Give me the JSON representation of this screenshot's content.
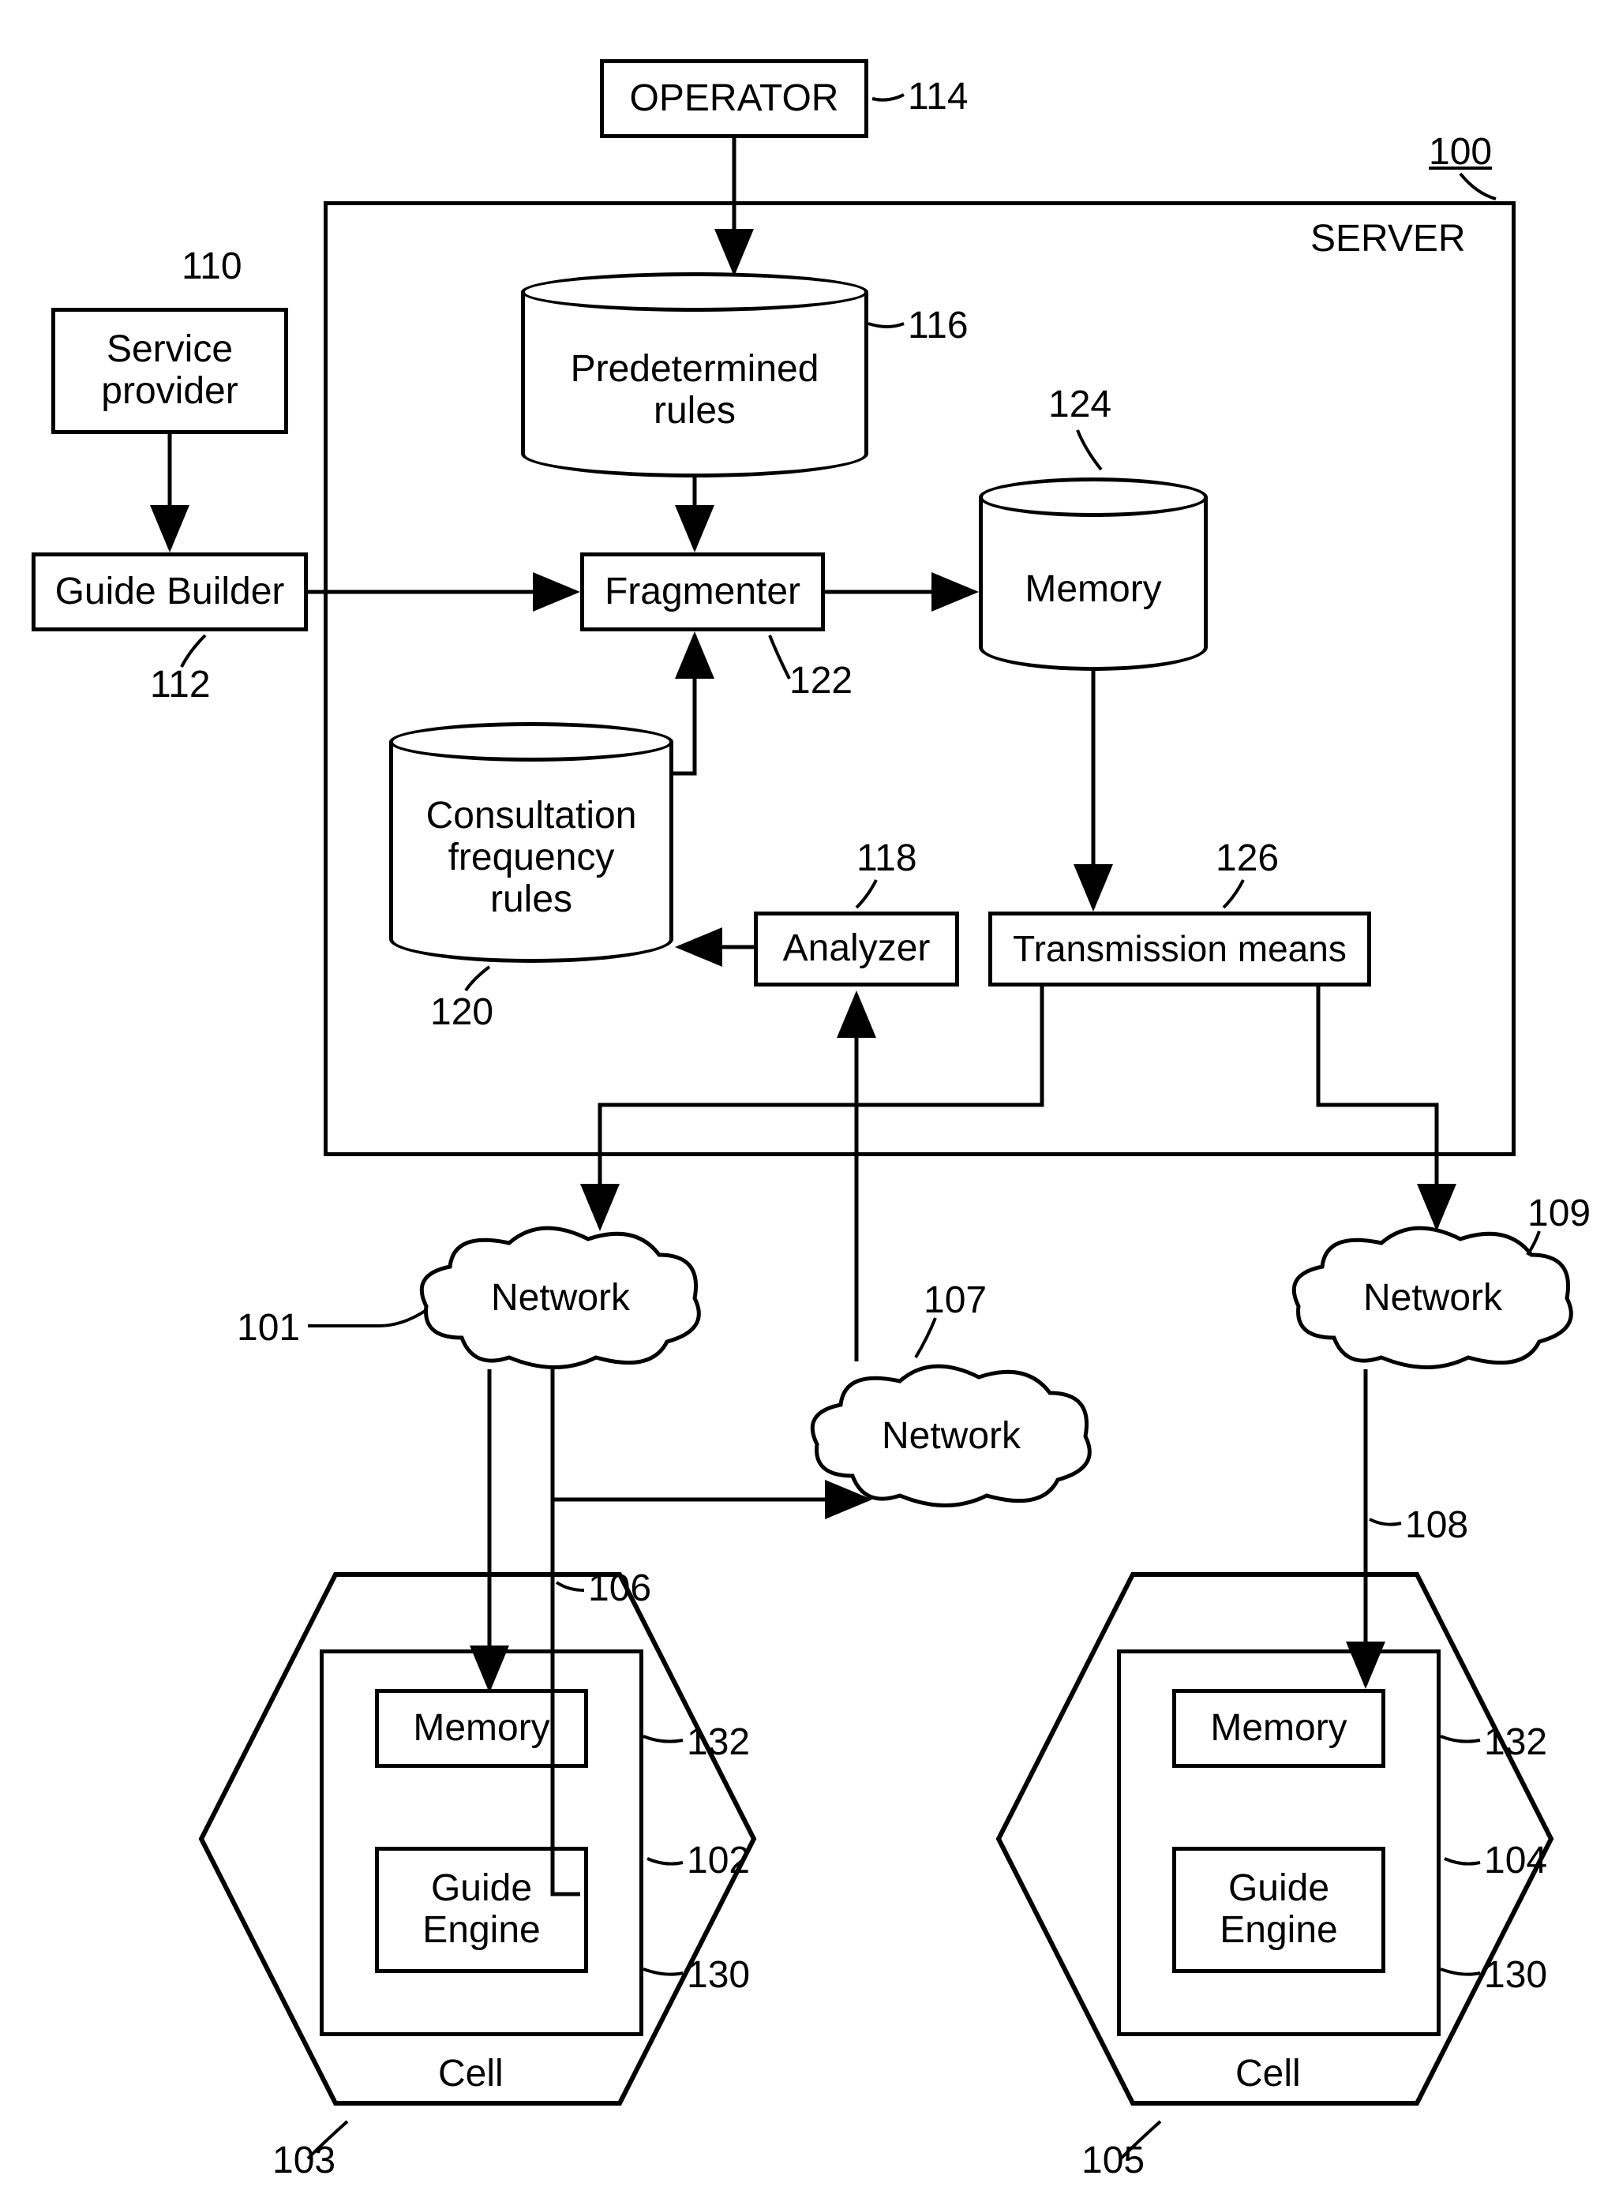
{
  "operator": {
    "label": "OPERATOR",
    "ref": "114"
  },
  "server": {
    "label": "SERVER",
    "ref": "100"
  },
  "service_provider": {
    "label": "Service\nprovider",
    "ref": "110"
  },
  "guide_builder": {
    "label": "Guide Builder",
    "ref": "112"
  },
  "predetermined_rules": {
    "label": "Predetermined\nrules",
    "ref": "116"
  },
  "fragmenter": {
    "label": "Fragmenter",
    "ref": "122"
  },
  "memory_server": {
    "label": "Memory",
    "ref": "124"
  },
  "consultation": {
    "label": "Consultation\nfrequency\nrules",
    "ref": "120"
  },
  "analyzer": {
    "label": "Analyzer",
    "ref": "118"
  },
  "transmission": {
    "label": "Transmission means",
    "ref": "126"
  },
  "network1": {
    "label": "Network",
    "ref": "101"
  },
  "network2": {
    "label": "Network",
    "ref": "107"
  },
  "network3": {
    "label": "Network",
    "ref": "109"
  },
  "cell1": {
    "label": "Cell",
    "ref": "103",
    "memory": {
      "label": "Memory",
      "ref": "132"
    },
    "guide_engine": {
      "label": "Guide\nEngine",
      "ref": "130"
    },
    "inner_ref": "102",
    "arrow_ref": "106"
  },
  "cell2": {
    "label": "Cell",
    "ref": "105",
    "memory": {
      "label": "Memory",
      "ref": "132"
    },
    "guide_engine": {
      "label": "Guide\nEngine",
      "ref": "130"
    },
    "inner_ref": "104",
    "arrow_ref": "108"
  }
}
